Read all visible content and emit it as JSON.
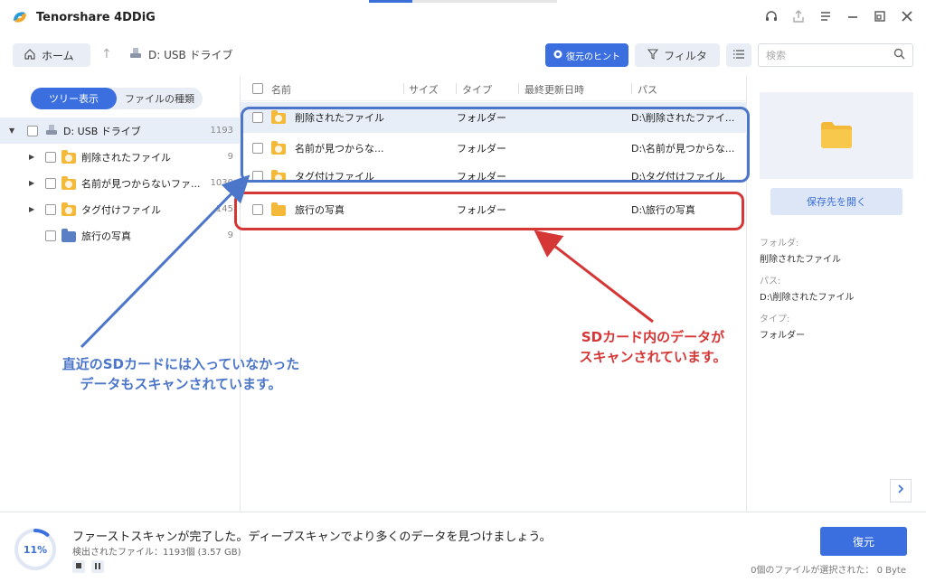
{
  "app": {
    "title": "Tenorshare 4DDiG"
  },
  "toolbar": {
    "home_label": "ホーム",
    "drive_label": "D: USB ドライブ",
    "hint_label": "復元のヒント",
    "filter_label": "フィルタ",
    "search_placeholder": "検索"
  },
  "sidebar": {
    "tabs": [
      "ツリー表示",
      "ファイルの種類"
    ],
    "active_tab": 0,
    "tree": [
      {
        "label": "D: USB ドライブ",
        "count": "1193",
        "level": 0,
        "expandable": true,
        "icon": "usb-drive-icon"
      },
      {
        "label": "削除されたファイル",
        "count": "9",
        "level": 1,
        "expandable": true,
        "icon": "deleted-folder-icon"
      },
      {
        "label": "名前が見つからないファ...",
        "count": "1030",
        "level": 1,
        "expandable": true,
        "icon": "unknown-folder-icon"
      },
      {
        "label": "タグ付けファイル",
        "count": "145",
        "level": 1,
        "expandable": true,
        "icon": "tagged-folder-icon"
      },
      {
        "label": "旅行の写真",
        "count": "9",
        "level": 1,
        "expandable": false,
        "icon": "blue-folder-icon"
      }
    ]
  },
  "list": {
    "headers": {
      "name": "名前",
      "size": "サイズ",
      "type": "タイプ",
      "modified": "最終更新日時",
      "path": "パス"
    },
    "rows": [
      {
        "name": "削除されたファイル",
        "type": "フォルダー",
        "path": "D:\\削除されたファイ...",
        "selected": true
      },
      {
        "name": "名前が見つからな...",
        "type": "フォルダー",
        "path": "D:\\名前が見つからな...",
        "selected": false
      },
      {
        "name": "タグ付けファイル",
        "type": "フォルダー",
        "path": "D:\\タグ付けファイル",
        "selected": false
      },
      {
        "name": "旅行の写真",
        "type": "フォルダー",
        "path": "D:\\旅行の写真",
        "selected": false
      }
    ]
  },
  "details": {
    "open_button": "保存先を開く",
    "folder_label": "フォルダ:",
    "folder_value": "削除されたファイル",
    "path_label": "パス:",
    "path_value": "D:\\削除されたファイル",
    "type_label": "タイプ:",
    "type_value": "フォルダー"
  },
  "bottom": {
    "progress_text": "11%",
    "progress_value": 0.11,
    "message": "ファーストスキャンが完了した。ディープスキャンでより多くのデータを見つけましょう。",
    "found_text": "検出されたファイル：1193個 (3.57 GB)",
    "recover_label": "復元",
    "selection_text": "0個のファイルが選択された： 0 Byte"
  },
  "annotations": {
    "blue_note_lines": [
      "直近のSDカードには入っていなかった",
      "データもスキャンされています。"
    ],
    "red_note_lines": [
      "SDカード内のデータが",
      "スキャンされています。"
    ],
    "blue_color": "#4c76c9",
    "red_color": "#d53636"
  },
  "colors": {
    "accent": "#3b6fe0",
    "folder": "#f5b93a"
  }
}
